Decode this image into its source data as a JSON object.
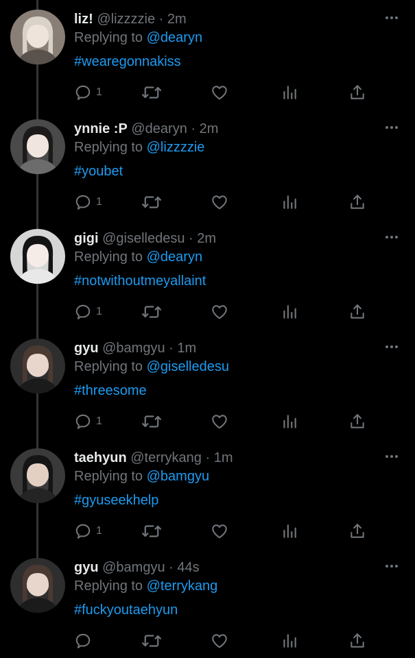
{
  "colors": {
    "background": "#000000",
    "accent": "#1d9bf0",
    "muted": "#71767b",
    "text": "#e7e9ea"
  },
  "tweets": [
    {
      "name": "liz!",
      "handle": "@lizzzzie",
      "time": "2m",
      "replying_label": "Replying to",
      "replying_to": "@dearyn",
      "hashtag": "#wearegonnakiss",
      "replies": "1"
    },
    {
      "name": "ynnie :P",
      "handle": "@dearyn",
      "time": "2m",
      "replying_label": "Replying to",
      "replying_to": "@lizzzzie",
      "hashtag": "#youbet",
      "replies": "1"
    },
    {
      "name": "gigi",
      "handle": "@giselledesu",
      "time": "2m",
      "replying_label": "Replying to",
      "replying_to": "@dearyn",
      "hashtag": "#notwithoutmeyallaint",
      "replies": "1"
    },
    {
      "name": "gyu",
      "handle": "@bamgyu",
      "time": "1m",
      "replying_label": "Replying to",
      "replying_to": "@giselledesu",
      "hashtag": "#threesome",
      "replies": "1"
    },
    {
      "name": "taehyun",
      "handle": "@terrykang",
      "time": "1m",
      "replying_label": "Replying to",
      "replying_to": "@bamgyu",
      "hashtag": "#gyuseekhelp",
      "replies": "1"
    },
    {
      "name": "gyu",
      "handle": "@bamgyu",
      "time": "44s",
      "replying_label": "Replying to",
      "replying_to": "@terrykang",
      "hashtag": "#fuckyoutaehyun",
      "replies": ""
    }
  ],
  "icons": {
    "reply": "reply-icon",
    "retweet": "retweet-icon",
    "like": "heart-icon",
    "views": "views-icon",
    "share": "share-icon",
    "more": "more-icon"
  }
}
